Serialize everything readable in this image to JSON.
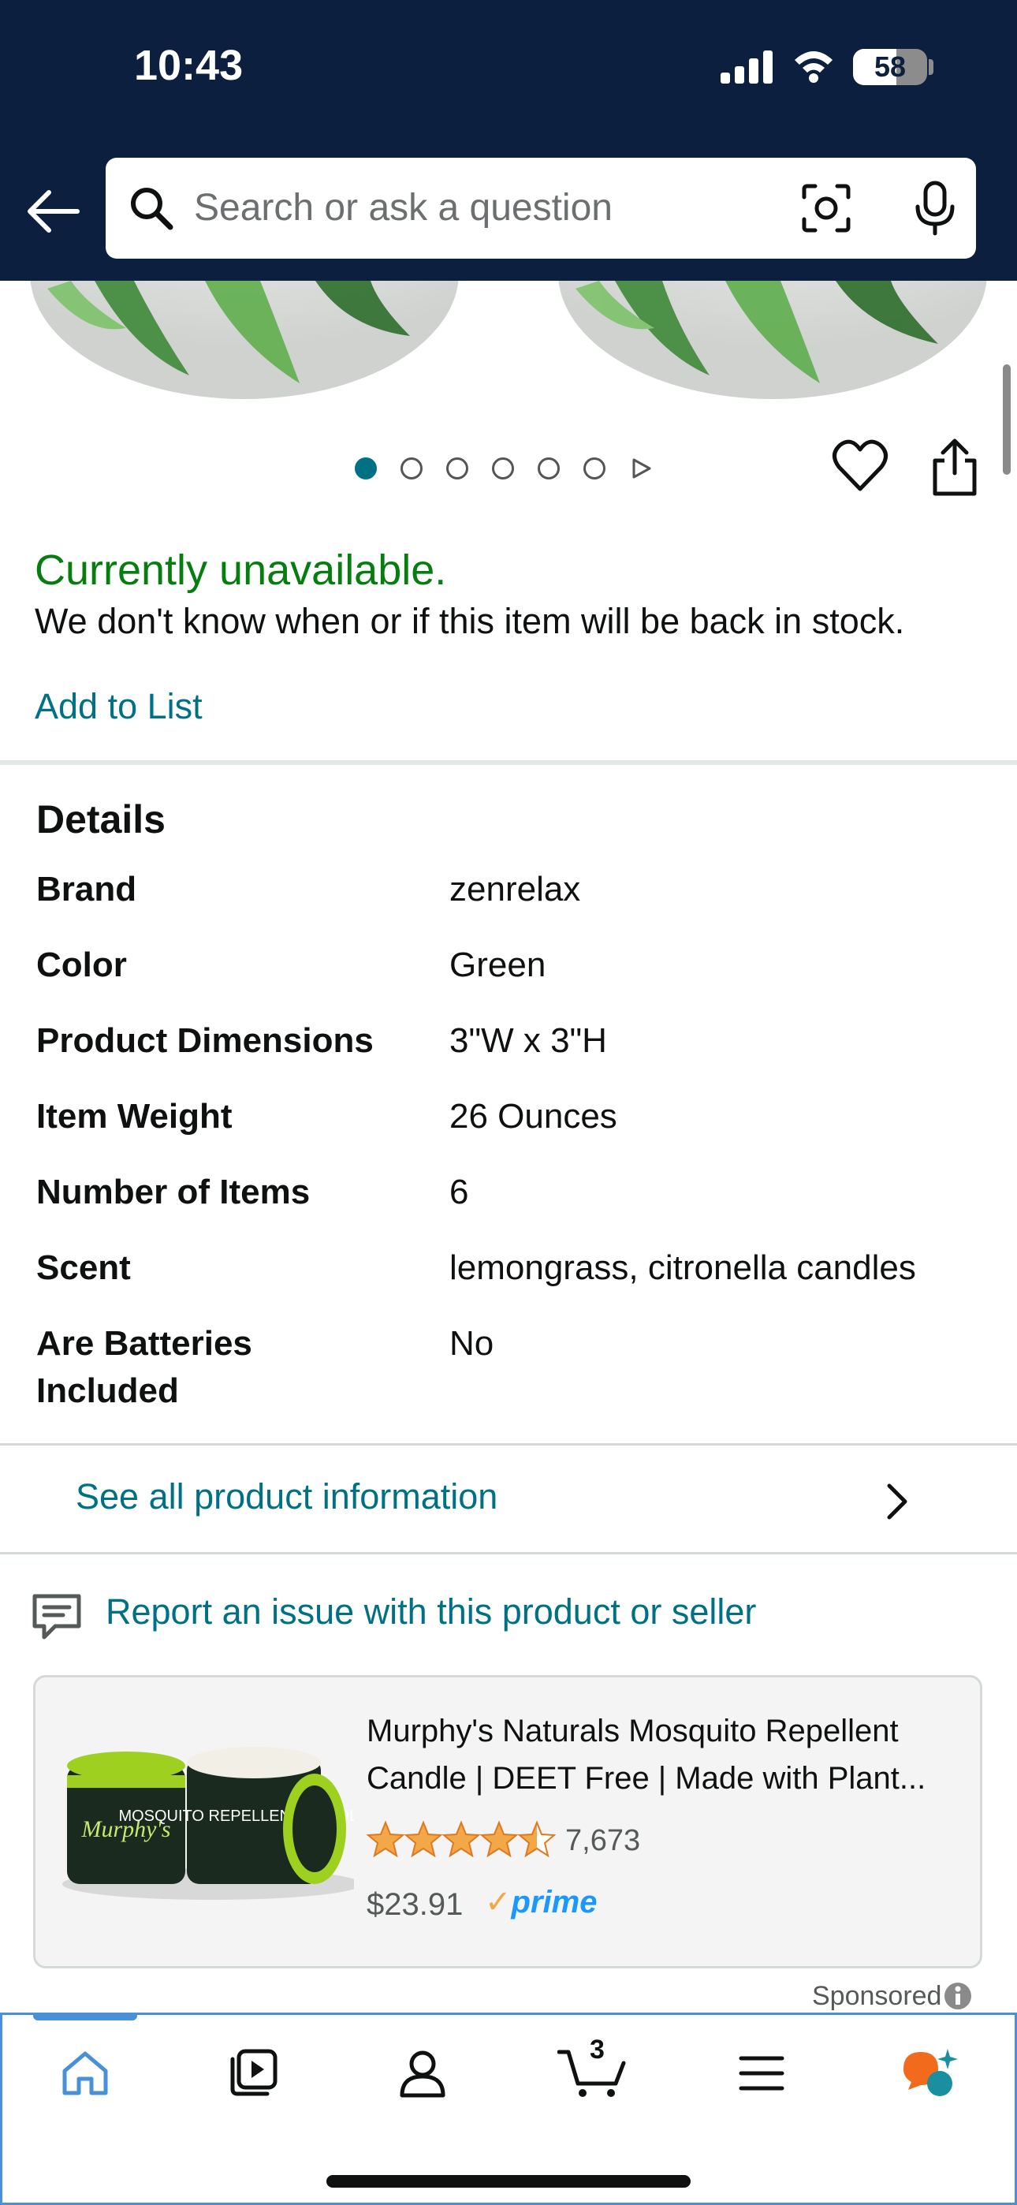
{
  "status_bar": {
    "time": "10:43",
    "battery": "58"
  },
  "search": {
    "placeholder": "Search or ask a question"
  },
  "carousel": {
    "dot_count": 6,
    "active_index": 0
  },
  "availability": {
    "status": "Currently unavailable.",
    "note": "We don't know when or if this item will be back in stock.",
    "add_to_list": "Add to List"
  },
  "details": {
    "title": "Details",
    "rows": [
      {
        "label": "Brand",
        "value": "zenrelax"
      },
      {
        "label": "Color",
        "value": "Green"
      },
      {
        "label": "Product Dimensions",
        "value": "3\"W x 3\"H"
      },
      {
        "label": "Item Weight",
        "value": "26 Ounces"
      },
      {
        "label": "Number of Items",
        "value": "6"
      },
      {
        "label": "Scent",
        "value": "lemongrass, citronella candles"
      },
      {
        "label": "Are Batteries Included",
        "value": "No"
      }
    ],
    "see_all": "See all product information"
  },
  "report": {
    "label": "Report an issue with this product or seller"
  },
  "sponsored_ad": {
    "title": "Murphy's Naturals Mosquito Repellent Candle | DEET Free | Made with Plant...",
    "rating": 4.5,
    "rating_count": "7,673",
    "price": "$23.91",
    "prime": "prime",
    "sponsored_label": "Sponsored",
    "image_text": {
      "brand": "Murphy's",
      "product": "MOSQUITO REPELLENT CANDLE"
    }
  },
  "bottom_nav": {
    "items": [
      "home-icon",
      "video-icon",
      "account-icon",
      "cart-icon",
      "menu-icon",
      "rufus-icon"
    ],
    "cart_count": "3",
    "active": "home"
  },
  "colors": {
    "header": "#0c1f3f",
    "link": "#007185",
    "available": "#067d0f",
    "star": "#f3a847",
    "nav_accent": "#4a90d9"
  }
}
